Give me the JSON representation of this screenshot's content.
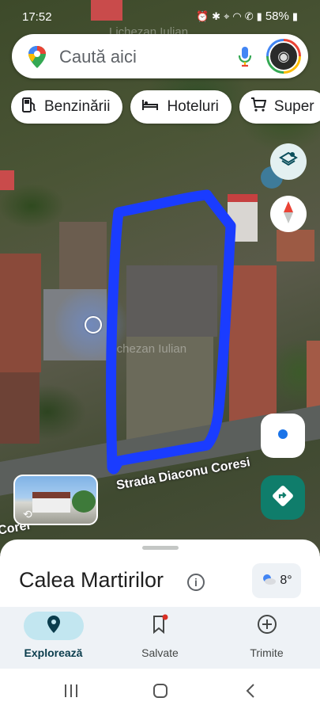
{
  "status_bar": {
    "time": "17:52",
    "battery": "58%"
  },
  "map": {
    "watermark": "Lichezan Iulian",
    "street_name": "Strada Diaconu Coresi",
    "street_name_partial": "Corel"
  },
  "search": {
    "placeholder": "Caută aici",
    "pin_icon": "google-maps-pin-icon",
    "mic_icon": "microphone-icon"
  },
  "chips": [
    {
      "label": "Benzinării",
      "icon": "gas-station-icon"
    },
    {
      "label": "Hoteluri",
      "icon": "bed-icon"
    },
    {
      "label": "Super",
      "icon": "shopping-cart-icon"
    }
  ],
  "place": {
    "title": "Calea Martirilor",
    "temperature": "8°"
  },
  "bottom_nav": {
    "items": [
      {
        "label": "Explorează",
        "icon": "location-pin-icon",
        "active": true
      },
      {
        "label": "Salvate",
        "icon": "bookmark-icon",
        "active": false
      },
      {
        "label": "Trimite",
        "icon": "add-circle-icon",
        "active": false
      }
    ]
  },
  "colors": {
    "outline": "#1a3cff",
    "directions_button": "#0f7d6b",
    "active_nav": "#c2e6f0"
  }
}
